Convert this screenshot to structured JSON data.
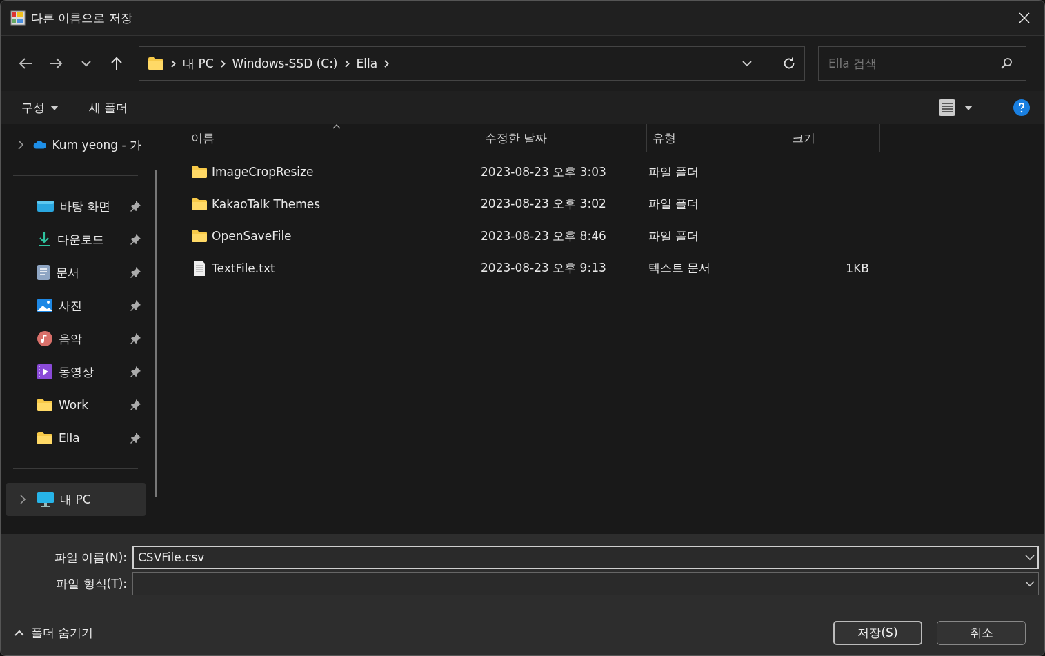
{
  "window": {
    "title": "다른 이름으로 저장"
  },
  "breadcrumb": [
    "내 PC",
    "Windows-SSD (C:)",
    "Ella"
  ],
  "search": {
    "placeholder": "Ella 검색"
  },
  "toolbar": {
    "organize": "구성",
    "new_folder": "새 폴더"
  },
  "sidebar": {
    "sections": [
      [
        {
          "label": "Kum yeong - 가",
          "kind": "cloud",
          "expandable": true,
          "pinned": false,
          "selected": false
        }
      ],
      [
        {
          "label": "바탕 화면",
          "kind": "desktop",
          "expandable": false,
          "pinned": true,
          "selected": false
        },
        {
          "label": "다운로드",
          "kind": "download",
          "expandable": false,
          "pinned": true,
          "selected": false
        },
        {
          "label": "문서",
          "kind": "documents",
          "expandable": false,
          "pinned": true,
          "selected": false
        },
        {
          "label": "사진",
          "kind": "pictures",
          "expandable": false,
          "pinned": true,
          "selected": false
        },
        {
          "label": "음악",
          "kind": "music",
          "expandable": false,
          "pinned": true,
          "selected": false
        },
        {
          "label": "동영상",
          "kind": "videos",
          "expandable": false,
          "pinned": true,
          "selected": false
        },
        {
          "label": "Work",
          "kind": "folder",
          "expandable": false,
          "pinned": true,
          "selected": false
        },
        {
          "label": "Ella",
          "kind": "folder",
          "expandable": false,
          "pinned": true,
          "selected": false
        }
      ],
      [
        {
          "label": "내 PC",
          "kind": "pc",
          "expandable": true,
          "pinned": false,
          "selected": true
        }
      ]
    ]
  },
  "table": {
    "columns": [
      {
        "label": "이름",
        "sorted": true
      },
      {
        "label": "수정한 날짜",
        "sorted": false
      },
      {
        "label": "유형",
        "sorted": false
      },
      {
        "label": "크기",
        "sorted": false
      }
    ],
    "rows": [
      {
        "kind": "folder",
        "name": "ImageCropResize",
        "date": "2023-08-23 오후 3:03",
        "type": "파일 폴더"
      },
      {
        "kind": "folder",
        "name": "KakaoTalk Themes",
        "date": "2023-08-23 오후 3:02",
        "type": "파일 폴더"
      },
      {
        "kind": "folder",
        "name": "OpenSaveFile",
        "date": "2023-08-23 오후 8:46",
        "type": "파일 폴더"
      },
      {
        "kind": "text",
        "name": "TextFile.txt",
        "date": "2023-08-23 오후 9:13",
        "type": "텍스트 문서",
        "size": "1KB"
      }
    ]
  },
  "form": {
    "file_name": {
      "label": "파일 이름(N):",
      "value": "CSVFile.csv"
    },
    "file_type": {
      "label": "파일 형식(T):"
    }
  },
  "hide_folders": "폴더 숨기기",
  "buttons": [
    {
      "label": "저장(S)",
      "default": true
    },
    {
      "label": "취소",
      "default": false
    }
  ]
}
